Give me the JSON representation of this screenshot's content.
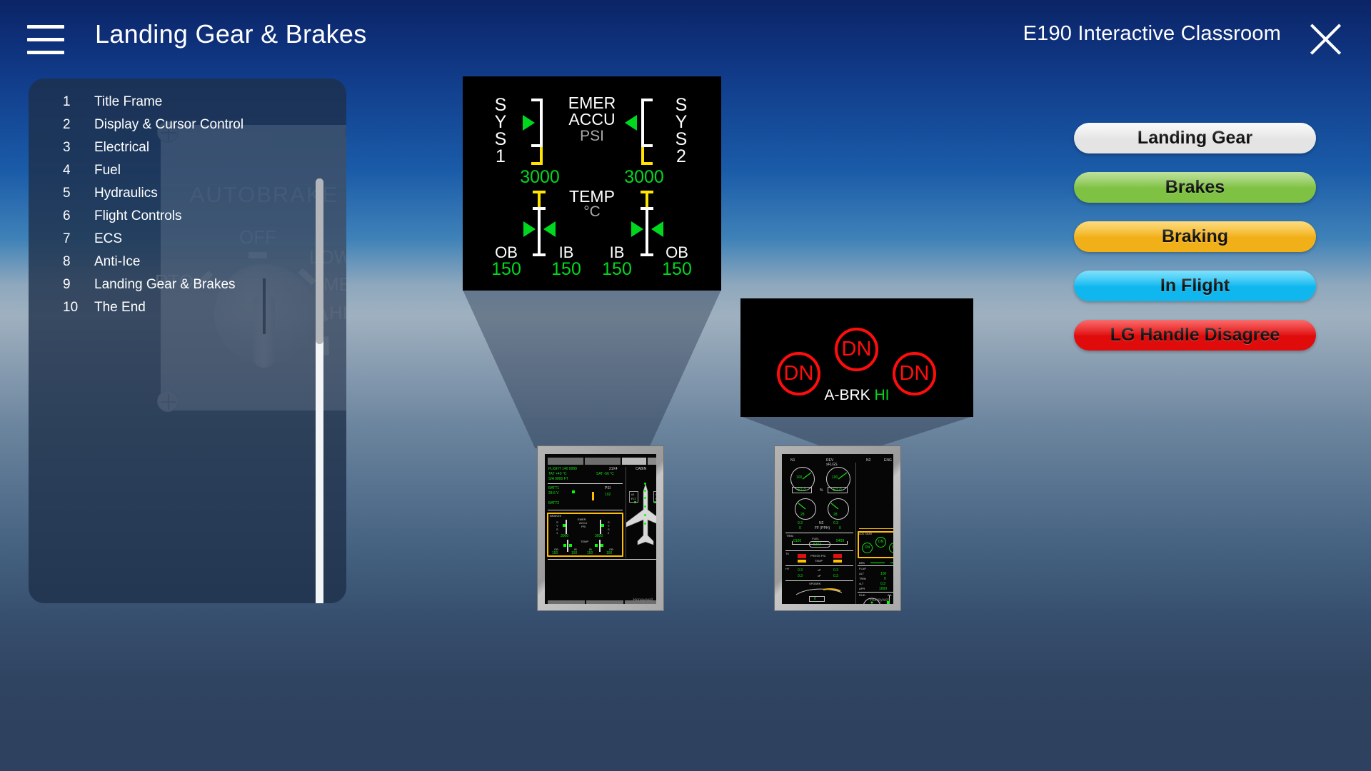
{
  "header": {
    "menu_icon": "hamburger-icon",
    "page_title": "Landing Gear & Brakes",
    "app_title": "E190 Interactive Classroom",
    "close_icon": "close-icon"
  },
  "sidebar": {
    "chat_icon": "speech-bubble-icon",
    "items": [
      {
        "num": "1",
        "label": "Title Frame"
      },
      {
        "num": "2",
        "label": "Display & Cursor Control"
      },
      {
        "num": "3",
        "label": "Electrical"
      },
      {
        "num": "4",
        "label": "Fuel"
      },
      {
        "num": "5",
        "label": "Hydraulics"
      },
      {
        "num": "6",
        "label": "Flight Controls"
      },
      {
        "num": "7",
        "label": "ECS"
      },
      {
        "num": "8",
        "label": "Anti-Ice"
      },
      {
        "num": "9",
        "label": "Landing Gear & Brakes"
      },
      {
        "num": "10",
        "label": "The End"
      }
    ],
    "background_art": {
      "panel_label": "AUTOBRAKE",
      "knob_positions": [
        "RTO",
        "OFF",
        "LOW",
        "MED",
        "HI"
      ],
      "selected": "OFF"
    }
  },
  "hydraulic_panel": {
    "sys1_label": "S\nY\nS\n1",
    "sys2_label": "S\nY\nS\n2",
    "sys1_letters": [
      "S",
      "Y",
      "S",
      "1"
    ],
    "sys2_letters": [
      "S",
      "Y",
      "S",
      "2"
    ],
    "title": "EMER",
    "title2": "ACCU",
    "unit": "PSI",
    "sys1_value": "3000",
    "sys2_value": "3000",
    "temp_title": "TEMP",
    "temp_unit": "°C",
    "brake_labels": [
      "OB",
      "IB",
      "IB",
      "OB"
    ],
    "brake_values": [
      "150",
      "150",
      "150",
      "150"
    ]
  },
  "gear_panel": {
    "indicators": [
      "DN",
      "DN",
      "DN"
    ],
    "abrk_label": "A-BRK",
    "abrk_value": "HI"
  },
  "thumbnails": [
    {
      "name": "mfd-thumbnail",
      "brand": "Honeywell"
    },
    {
      "name": "eicas-thumbnail",
      "brand": "Honeywell"
    }
  ],
  "topic_buttons": [
    {
      "label": "Landing Gear",
      "color": "#e4e4e4",
      "color2": "#f7f7f7"
    },
    {
      "label": "Brakes",
      "color": "#7ec143",
      "color2": "#9ed16a"
    },
    {
      "label": "Braking",
      "color": "#f2b018",
      "color2": "#fcc93f"
    },
    {
      "label": "In Flight",
      "color": "#10b7ef",
      "color2": "#3fd2fb"
    },
    {
      "label": "LG Handle Disagree",
      "color": "#e00c0c",
      "color2": "#f52020"
    }
  ],
  "colors": {
    "accent_green": "#00d820",
    "accent_red": "#ff0d0d",
    "accent_yellow": "#ffe400",
    "panel_bg": "#000000",
    "sidebar_bg": "rgba(30,48,74,0.80)"
  }
}
